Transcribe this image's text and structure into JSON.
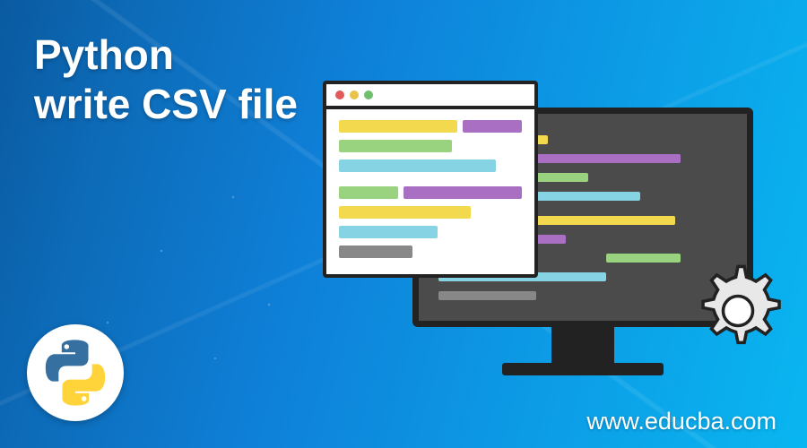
{
  "title_line1": "Python",
  "title_line2": "write CSV file",
  "url": "www.educba.com",
  "logo_name": "python-logo",
  "colors": {
    "yellow": "#f2d94e",
    "green": "#9ad37f",
    "purple": "#a96fc2",
    "cyan": "#86d3e3",
    "gray": "#888888",
    "traffic_red": "#e05a5a",
    "traffic_yellow": "#e8c34a",
    "traffic_green": "#6fbf6f"
  }
}
